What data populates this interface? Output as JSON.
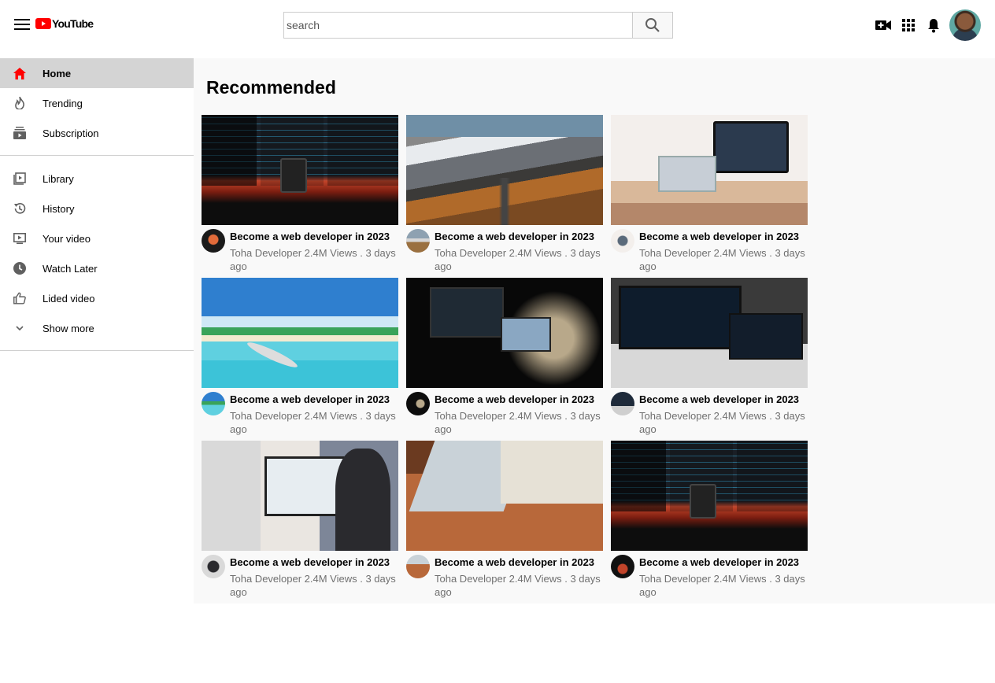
{
  "header": {
    "logo_text": "YouTube",
    "search_placeholder": "search"
  },
  "sidebar": {
    "primary": [
      {
        "label": "Home",
        "icon": "home-icon",
        "active": true
      },
      {
        "label": "Trending",
        "icon": "flame-icon"
      },
      {
        "label": "Subscription",
        "icon": "subscriptions-icon"
      }
    ],
    "secondary": [
      {
        "label": "Library",
        "icon": "library-icon"
      },
      {
        "label": "History",
        "icon": "history-icon"
      },
      {
        "label": "Your video",
        "icon": "your-video-icon"
      },
      {
        "label": "Watch Later",
        "icon": "clock-icon"
      },
      {
        "label": "Lided video",
        "icon": "thumbs-up-icon"
      },
      {
        "label": "Show more",
        "icon": "chevron-down-icon"
      }
    ]
  },
  "main": {
    "title": "Recommended",
    "videos": [
      {
        "title": "Become a web developer in 2023",
        "meta": "Toha Developer 2.4M Views . 3 days ago"
      },
      {
        "title": "Become a web developer in 2023",
        "meta": "Toha Developer 2.4M Views . 3 days ago"
      },
      {
        "title": "Become a web developer in 2023",
        "meta": "Toha Developer 2.4M Views . 3 days ago"
      },
      {
        "title": "Become a web developer in 2023",
        "meta": "Toha Developer 2.4M Views . 3 days ago"
      },
      {
        "title": "Become a web developer in 2023",
        "meta": "Toha Developer 2.4M Views . 3 days ago"
      },
      {
        "title": "Become a web developer in 2023",
        "meta": "Toha Developer 2.4M Views . 3 days ago"
      },
      {
        "title": "Become a web developer in 2023",
        "meta": "Toha Developer 2.4M Views . 3 days ago"
      },
      {
        "title": "Become a web developer in 2023",
        "meta": "Toha Developer 2.4M Views . 3 days ago"
      },
      {
        "title": "Become a web developer in 2023",
        "meta": "Toha Developer 2.4M Views . 3 days ago"
      }
    ]
  },
  "colors": {
    "brand_red": "#ff0000",
    "active_item_bg": "#d4d4d4",
    "main_bg": "#f9f9f9",
    "meta_text": "#707070"
  }
}
